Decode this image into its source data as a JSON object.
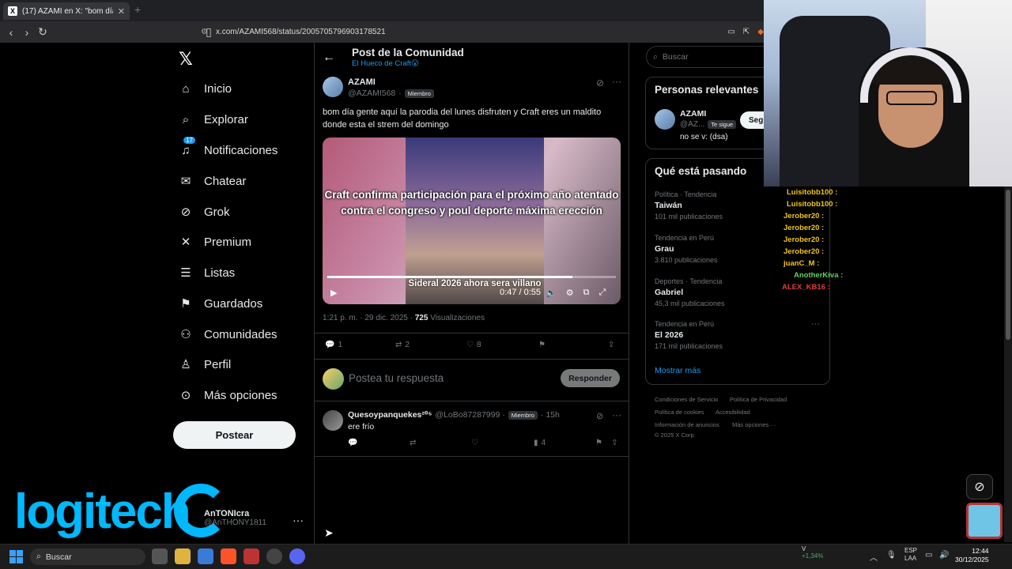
{
  "browser": {
    "tab_title": "(17) AZAMI en X: \"bom día gente",
    "tab_favicon": "X",
    "url": "x.com/AZAMI568/status/2005705796903178521"
  },
  "nav": {
    "items": [
      {
        "label": "Inicio",
        "icon": "home-icon"
      },
      {
        "label": "Explorar",
        "icon": "search-icon"
      },
      {
        "label": "Notificaciones",
        "icon": "bell-icon",
        "badge": "17"
      },
      {
        "label": "Chatear",
        "icon": "mail-icon"
      },
      {
        "label": "Grok",
        "icon": "grok-icon"
      },
      {
        "label": "Premium",
        "icon": "x-icon"
      },
      {
        "label": "Listas",
        "icon": "list-icon"
      },
      {
        "label": "Guardados",
        "icon": "bookmark-icon"
      },
      {
        "label": "Comunidades",
        "icon": "people-icon"
      },
      {
        "label": "Perfil",
        "icon": "person-icon"
      },
      {
        "label": "Más opciones",
        "icon": "more-circle-icon"
      }
    ],
    "post_button": "Postear"
  },
  "watermark": {
    "brand": "logitech"
  },
  "account": {
    "name": "AnTONIcra",
    "handle": "@AnTHONY1811"
  },
  "header": {
    "title": "Post de la Comunidad",
    "subtitle": "El Hueco de Craft😮"
  },
  "tweet": {
    "name": "AZAMI",
    "handle": "@AZAMI568",
    "member_badge": "Miembro",
    "text": "bom día gente aquí la parodia del lunes disfruten y Craft eres un maldito donde esta el strem del domingo",
    "video_caption": "Craft confirma participación para el próximo año atentado contra el congreso y poul deporte máxima erección",
    "video_caption2": "Sideral 2026 ahora sera villano",
    "video_time": "0:47 / 0:55",
    "video_progress": 0.85,
    "timestamp": "1:21 p. m. · 29 dic. 2025 ·",
    "views_count": "725",
    "views_label": "Visualizaciones",
    "replies": "1",
    "reposts": "2",
    "likes": "8"
  },
  "reply_box": {
    "placeholder": "Postea tu respuesta",
    "button": "Responder"
  },
  "reply": {
    "name": "Quesoypanquekes²⁰⁵",
    "handle": "@LoBo87287999 ·",
    "member_badge": "Miembro",
    "time": "· 15h",
    "text": "ere frío",
    "views": "4"
  },
  "sidebar": {
    "search_placeholder": "Buscar",
    "relevant_title": "Personas relevantes",
    "relevant_user": {
      "name": "AZAMI",
      "handle": "@AZ...",
      "follows_you": "Te sigue",
      "bio": "no se v: (dsa)",
      "follow_button": "Seg"
    },
    "trends_title": "Qué está pasando",
    "trends": [
      {
        "category": "Política · Tendencia",
        "name": "Taiwán",
        "count": "101 mil publicaciones"
      },
      {
        "category": "Tendencia en Perú",
        "name": "Grau",
        "count": "3.810 publicaciones"
      },
      {
        "category": "Deportes · Tendencia",
        "name": "Gabriel",
        "count": "45,3 mil publicaciones"
      },
      {
        "category": "Tendencia en Perú",
        "name": "El 2026",
        "count": "171 mil publicaciones"
      }
    ],
    "show_more": "Mostrar más",
    "footer": {
      "line1a": "Condiciones de Servicio",
      "line1b": "Política de Privacidad",
      "line2a": "Política de cookies",
      "line2b": "Accesibilidad",
      "line3a": "Información de anuncios",
      "line3b": "Más opciones ···",
      "copyright": "© 2025 X Corp."
    }
  },
  "chat": [
    {
      "user": "Luisitobb100 :",
      "color": "#f0c419"
    },
    {
      "user": "Luisitobb100 :",
      "color": "#f0c419"
    },
    {
      "user": "Jerober20 :",
      "color": "#f0c419"
    },
    {
      "user": "Jerober20 :",
      "color": "#f0c419"
    },
    {
      "user": "Jerober20 :",
      "color": "#f0c419"
    },
    {
      "user": "Jerober20 :",
      "color": "#f0c419"
    },
    {
      "user": "juanC_M :",
      "color": "#f0c419"
    },
    {
      "user": "AnotherKiva :",
      "color": "#5fd35f"
    },
    {
      "user": "ALEX_KB16 :",
      "color": "#e03c3c"
    }
  ],
  "taskbar": {
    "search": "Buscar",
    "stock_name": "V",
    "stock_change": "+1,34%",
    "lang1": "ESP",
    "lang2": "LAA",
    "time": "12:44",
    "date": "30/12/2025"
  }
}
